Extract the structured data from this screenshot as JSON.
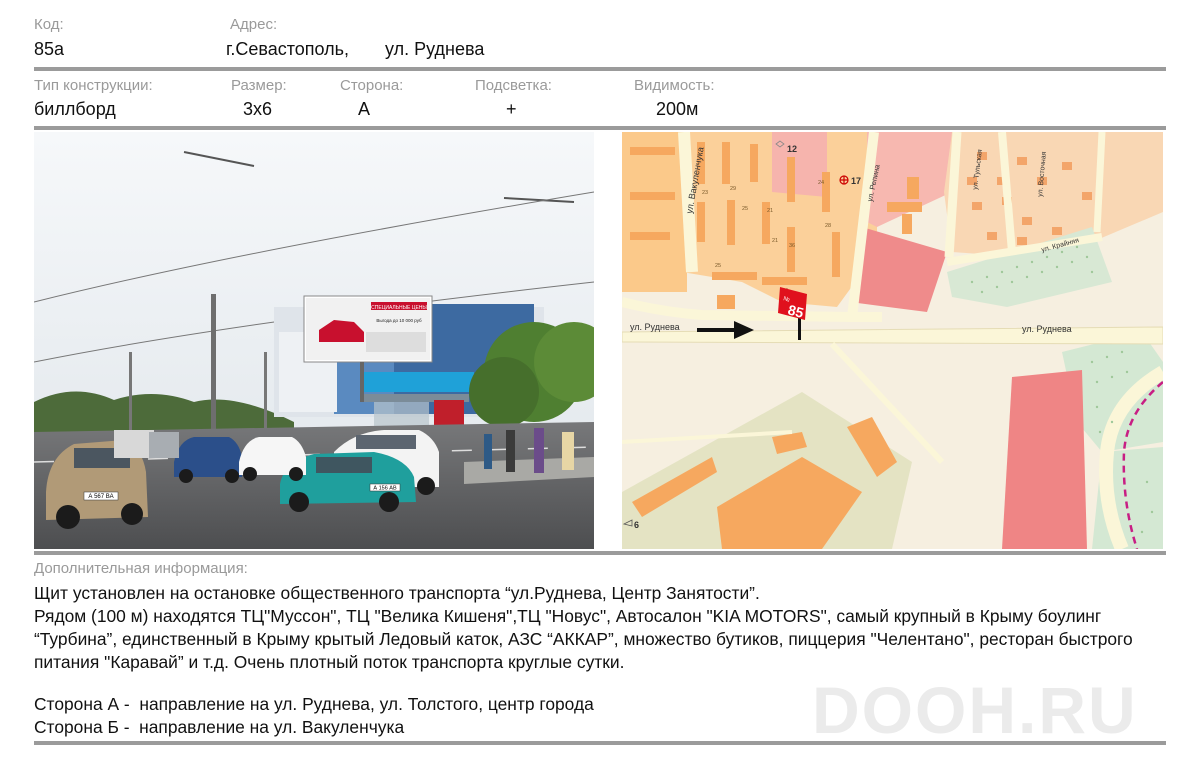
{
  "header": {
    "code_label": "Код:",
    "code_value": "85а",
    "address_label": "Адрес:",
    "address_city": "г.Севастополь,",
    "address_street": "ул. Руднева"
  },
  "specs": {
    "type_label": "Тип конструкции:",
    "type_value": "биллборд",
    "size_label": "Размер:",
    "size_value": "3х6",
    "side_label": "Сторона:",
    "side_value": "А",
    "light_label": "Подсветка:",
    "light_value": "+",
    "visibility_label": "Видимость:",
    "visibility_value": "200м"
  },
  "photo": {
    "billboard_caption": "СПЕЦИАЛЬНЫЕ ЦЕНЫ",
    "billboard_price": "Выгода до 10 000 руб",
    "plate_1": "А 567 ВА",
    "plate_2": "А 156 АВ"
  },
  "map": {
    "street_rudneva_left": "ул. Руднева",
    "street_rudneva_right": "ул. Руднева",
    "street_vakulenchuka": "ул. Вакуленчука",
    "street_repina": "ул. Репина",
    "street_tulskaya": "ул. Тульская",
    "street_vostochnaya": "ул. Восточная",
    "street_krainyaya": "ул. Крайняя",
    "marker_number": "85",
    "marker_prefix": "№",
    "poi_12": "12",
    "poi_17": "17",
    "poi_6": "6",
    "house_numbers": [
      "23",
      "29",
      "25",
      "21",
      "21",
      "24",
      "36",
      "28",
      "25",
      "34"
    ]
  },
  "additional": {
    "label": "Дополнительная информация:",
    "paragraph_1": "Щит установлен на остановке общественного транспорта “ул.Руднева, Центр Занятости”.",
    "paragraph_2": "Рядом (100 м) находятся ТЦ\"Муссон\", ТЦ \"Велика Кишеня\",ТЦ \"Новус\", Автосалон \"KIA MOTORS\", самый крупный в Крыму боулинг “Турбина”, единственный в Крыму крытый Ледовый каток, АЗС “АККАР”, множество бутиков, пиццерия \"Челентано\", ресторан быстрого питания \"Каравай” и т.д. Очень плотный поток транспорта круглые сутки.",
    "side_a": "Сторона А -  направление на ул. Руднева, ул. Толстого, центр города",
    "side_b": "Сторона Б -  направление на ул. Вакуленчука"
  },
  "watermark": "DOOH.RU"
}
